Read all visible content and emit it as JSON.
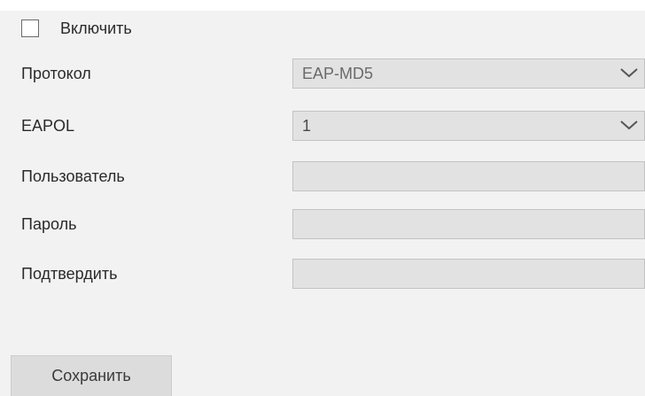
{
  "enable": {
    "label": "Включить",
    "checked": false
  },
  "form": {
    "protocol": {
      "label": "Протокол",
      "value": "EAP-MD5",
      "icon": "chevron-down-icon"
    },
    "eapol": {
      "label": "EAPOL",
      "value": "1",
      "icon": "chevron-down-icon"
    },
    "user": {
      "label": "Пользователь",
      "value": ""
    },
    "password": {
      "label": "Пароль",
      "value": ""
    },
    "confirm": {
      "label": "Подтвердить",
      "value": ""
    }
  },
  "actions": {
    "save_label": "Сохранить"
  },
  "colors": {
    "background": "#f2f2f2",
    "field_fill": "#e2e2e2",
    "field_border": "#c3c3c3",
    "button_fill": "#dcdcdc"
  }
}
